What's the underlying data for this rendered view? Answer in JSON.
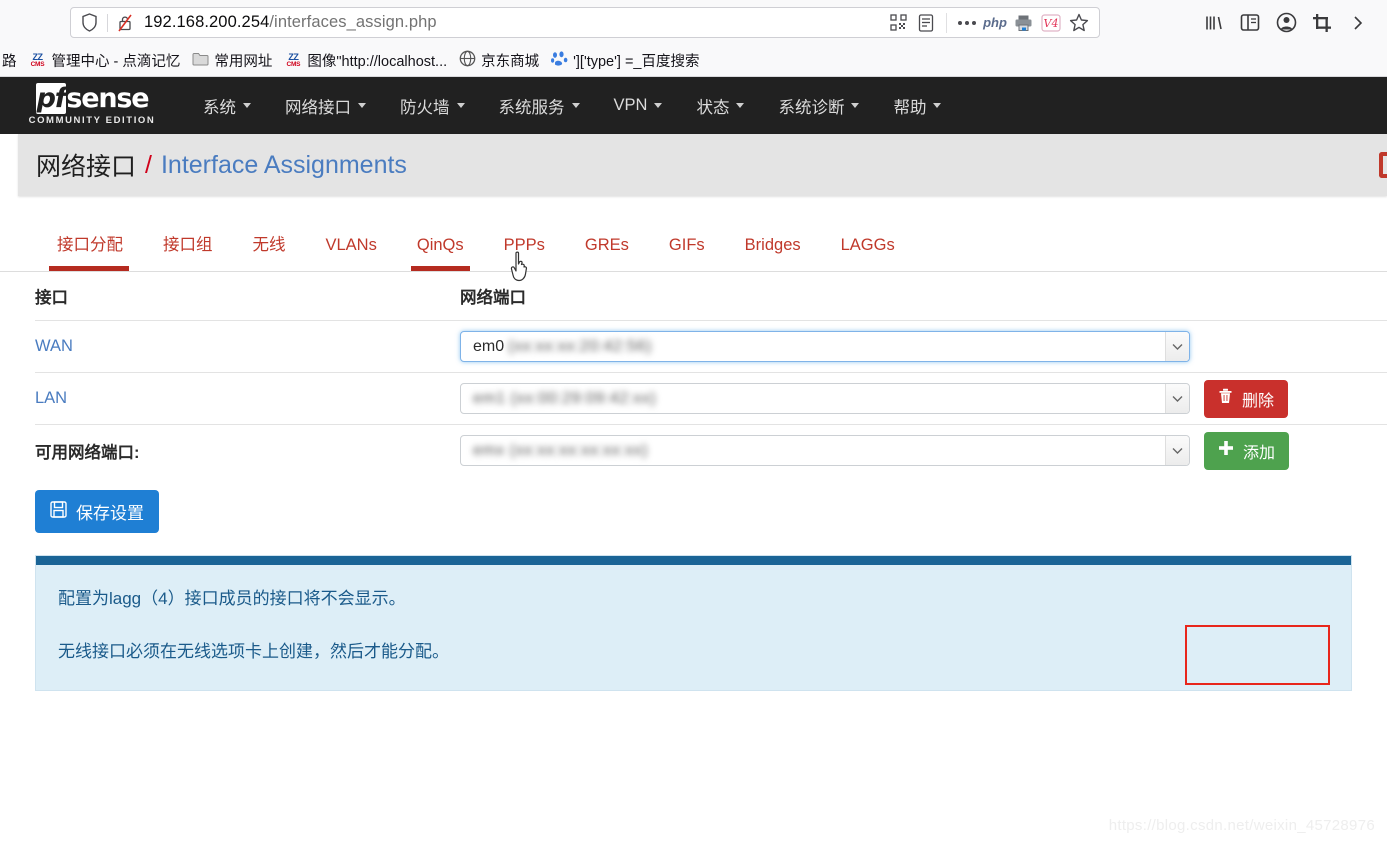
{
  "browser": {
    "url_host": "192.168.200.254",
    "url_path": "/interfaces_assign.php",
    "icons": {
      "shield": "shield-icon",
      "lock_broken": "broken-lock-icon",
      "qr": "qr-code-icon",
      "reader": "reader-view-icon",
      "more": "more-dots-icon",
      "php": "php",
      "printer": "printer-icon",
      "v4": "V4",
      "star": "bookmark-star-icon",
      "library": "library-icon",
      "sidebar": "sidebar-icon",
      "account": "account-icon",
      "screenshot": "screenshot-crop-icon"
    },
    "bookmarks": [
      {
        "label": "路",
        "icon": "partial-bookmark"
      },
      {
        "label": "管理中心 - 点滴记忆",
        "icon": "zzcms-icon"
      },
      {
        "label": "常用网址",
        "icon": "folder-icon"
      },
      {
        "label": "图像\"http://localhost...",
        "icon": "zzcms-icon"
      },
      {
        "label": "京东商城",
        "icon": "globe-icon"
      },
      {
        "label": "']['type'] =_百度搜索",
        "icon": "baidu-icon"
      }
    ]
  },
  "navbar": {
    "brand": "pfsense",
    "brand_pf": "pf",
    "brand_sense": "sense",
    "brand_sub": "COMMUNITY EDITION",
    "items": [
      {
        "label": "系统"
      },
      {
        "label": "网络接口"
      },
      {
        "label": "防火墙"
      },
      {
        "label": "系统服务"
      },
      {
        "label": "VPN"
      },
      {
        "label": "状态"
      },
      {
        "label": "系统诊断"
      },
      {
        "label": "帮助"
      }
    ]
  },
  "breadcrumb": {
    "parent": "网络接口",
    "separator": "/",
    "current": "Interface Assignments"
  },
  "tabs": [
    {
      "label": "接口分配",
      "active": true
    },
    {
      "label": "接口组",
      "active": false
    },
    {
      "label": "无线",
      "active": false
    },
    {
      "label": "VLANs",
      "active": false
    },
    {
      "label": "QinQs",
      "active": false,
      "hover": true
    },
    {
      "label": "PPPs",
      "active": false
    },
    {
      "label": "GREs",
      "active": false
    },
    {
      "label": "GIFs",
      "active": false
    },
    {
      "label": "Bridges",
      "active": false
    },
    {
      "label": "LAGGs",
      "active": false
    }
  ],
  "table": {
    "headers": {
      "interface": "接口",
      "port": "网络端口"
    },
    "rows": [
      {
        "name": "WAN",
        "port_prefix": "em0",
        "port_blurred": "(xx:xx:xx:20:42:56)",
        "focused": true,
        "action": null
      },
      {
        "name": "LAN",
        "port_prefix": "em1",
        "port_blurred": "(xx:00:29:09:42:xx)",
        "focused": false,
        "action": "delete"
      }
    ],
    "available_label": "可用网络端口:",
    "available_blurred": "emx (xx:xx:xx:xx:xx:xx)"
  },
  "buttons": {
    "delete": "删除",
    "add": "添加",
    "save": "保存设置"
  },
  "panel": {
    "lines": [
      "配置为lagg（4）接口成员的接口将不会显示。",
      "无线接口必须在无线选项卡上创建，然后才能分配。"
    ]
  },
  "watermark": "https://blog.csdn.net/weixin_45728976",
  "colors": {
    "navbar_bg": "#212121",
    "tab_red": "#c0392b",
    "link_blue": "#4a7cc0",
    "delete_red": "#c9302c",
    "add_green": "#4ea24e",
    "save_blue": "#1f7fd4",
    "panel_bg": "#ddeef7",
    "panel_head": "#1a6496",
    "annotation_red": "#e8261b"
  }
}
